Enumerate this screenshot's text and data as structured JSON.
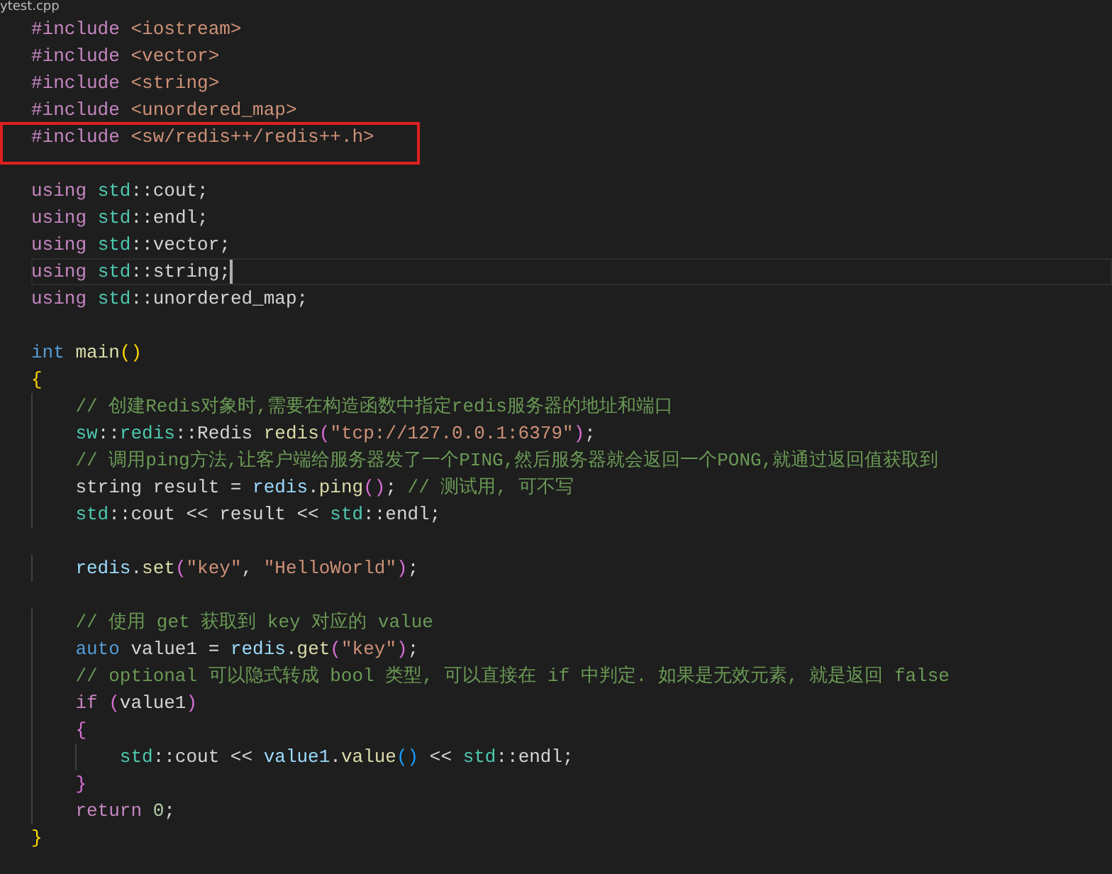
{
  "tab": {
    "title": "ytest.cpp"
  },
  "lines": [
    {
      "kind": "code",
      "tokens": [
        {
          "text": "#include",
          "kind": "pp"
        },
        {
          "text": " <iostream>",
          "kind": "str"
        }
      ]
    },
    {
      "kind": "code",
      "tokens": [
        {
          "text": "#include",
          "kind": "pp"
        },
        {
          "text": " <vector>",
          "kind": "str"
        }
      ]
    },
    {
      "kind": "code",
      "tokens": [
        {
          "text": "#include",
          "kind": "pp"
        },
        {
          "text": " <string>",
          "kind": "str"
        }
      ]
    },
    {
      "kind": "code",
      "tokens": [
        {
          "text": "#include",
          "kind": "pp"
        },
        {
          "text": " <unordered_map>",
          "kind": "str"
        }
      ]
    },
    {
      "kind": "code",
      "annotated": true,
      "tokens": [
        {
          "text": "#include",
          "kind": "pp"
        },
        {
          "text": " <sw/redis++/redis++.h>",
          "kind": "str"
        }
      ]
    },
    {
      "kind": "blank"
    },
    {
      "kind": "code",
      "tokens": [
        {
          "text": "using",
          "kind": "kw"
        },
        {
          "text": " std",
          "kind": "ns"
        },
        {
          "text": "::cout;",
          "kind": "plain"
        }
      ]
    },
    {
      "kind": "code",
      "tokens": [
        {
          "text": "using",
          "kind": "kw"
        },
        {
          "text": " std",
          "kind": "ns"
        },
        {
          "text": "::endl;",
          "kind": "plain"
        }
      ]
    },
    {
      "kind": "code",
      "tokens": [
        {
          "text": "using",
          "kind": "kw"
        },
        {
          "text": " std",
          "kind": "ns"
        },
        {
          "text": "::vector;",
          "kind": "plain"
        }
      ]
    },
    {
      "kind": "code",
      "cursor": true,
      "tokens": [
        {
          "text": "using",
          "kind": "kw"
        },
        {
          "text": " std",
          "kind": "ns"
        },
        {
          "text": "::string;",
          "kind": "plain"
        }
      ]
    },
    {
      "kind": "code",
      "tokens": [
        {
          "text": "using",
          "kind": "kw"
        },
        {
          "text": " std",
          "kind": "ns"
        },
        {
          "text": "::unordered_map;",
          "kind": "plain"
        }
      ]
    },
    {
      "kind": "blank"
    },
    {
      "kind": "code",
      "tokens": [
        {
          "text": "int",
          "kind": "type"
        },
        {
          "text": " main",
          "kind": "fn"
        },
        {
          "text": "()",
          "kind": "b1"
        }
      ]
    },
    {
      "kind": "code",
      "tokens": [
        {
          "text": "{",
          "kind": "b1"
        }
      ]
    },
    {
      "kind": "code",
      "tokens": [
        {
          "text": "    // 创建Redis对象时,需要在构造函数中指定redis服务器的地址和端口",
          "kind": "com"
        }
      ]
    },
    {
      "kind": "code",
      "tokens": [
        {
          "text": "    sw",
          "kind": "ns"
        },
        {
          "text": "::",
          "kind": "plain"
        },
        {
          "text": "redis",
          "kind": "ns"
        },
        {
          "text": "::Redis ",
          "kind": "plain"
        },
        {
          "text": "redis",
          "kind": "fn"
        },
        {
          "text": "(",
          "kind": "b2"
        },
        {
          "text": "\"tcp://127.0.0.1:6379\"",
          "kind": "str"
        },
        {
          "text": ")",
          "kind": "b2"
        },
        {
          "text": ";",
          "kind": "plain"
        }
      ]
    },
    {
      "kind": "code",
      "tokens": [
        {
          "text": "    // 调用ping方法,让客户端给服务器发了一个PING,然后服务器就会返回一个PONG,就通过返回值获取到",
          "kind": "com"
        }
      ]
    },
    {
      "kind": "code",
      "tokens": [
        {
          "text": "    string result = ",
          "kind": "plain"
        },
        {
          "text": "redis",
          "kind": "var"
        },
        {
          "text": ".",
          "kind": "plain"
        },
        {
          "text": "ping",
          "kind": "fn"
        },
        {
          "text": "()",
          "kind": "b2"
        },
        {
          "text": "; ",
          "kind": "plain"
        },
        {
          "text": "// 测试用, 可不写",
          "kind": "com"
        }
      ]
    },
    {
      "kind": "code",
      "tokens": [
        {
          "text": "    std",
          "kind": "ns"
        },
        {
          "text": "::cout << result << ",
          "kind": "plain"
        },
        {
          "text": "std",
          "kind": "ns"
        },
        {
          "text": "::endl;",
          "kind": "plain"
        }
      ]
    },
    {
      "kind": "blank"
    },
    {
      "kind": "code",
      "tokens": [
        {
          "text": "    redis",
          "kind": "var"
        },
        {
          "text": ".",
          "kind": "plain"
        },
        {
          "text": "set",
          "kind": "fn"
        },
        {
          "text": "(",
          "kind": "b2"
        },
        {
          "text": "\"key\"",
          "kind": "str"
        },
        {
          "text": ", ",
          "kind": "plain"
        },
        {
          "text": "\"HelloWorld\"",
          "kind": "str"
        },
        {
          "text": ")",
          "kind": "b2"
        },
        {
          "text": ";",
          "kind": "plain"
        }
      ]
    },
    {
      "kind": "blank"
    },
    {
      "kind": "code",
      "tokens": [
        {
          "text": "    // 使用 get 获取到 key 对应的 value",
          "kind": "com"
        }
      ]
    },
    {
      "kind": "code",
      "tokens": [
        {
          "text": "    auto",
          "kind": "type"
        },
        {
          "text": " value1 = ",
          "kind": "plain"
        },
        {
          "text": "redis",
          "kind": "var"
        },
        {
          "text": ".",
          "kind": "plain"
        },
        {
          "text": "get",
          "kind": "fn"
        },
        {
          "text": "(",
          "kind": "b2"
        },
        {
          "text": "\"key\"",
          "kind": "str"
        },
        {
          "text": ")",
          "kind": "b2"
        },
        {
          "text": ";",
          "kind": "plain"
        }
      ]
    },
    {
      "kind": "code",
      "tokens": [
        {
          "text": "    // optional 可以隐式转成 bool 类型, 可以直接在 if 中判定. 如果是无效元素, 就是返回 false",
          "kind": "com"
        }
      ]
    },
    {
      "kind": "code",
      "tokens": [
        {
          "text": "    if ",
          "kind": "kw"
        },
        {
          "text": "(",
          "kind": "b2"
        },
        {
          "text": "value1",
          "kind": "plain"
        },
        {
          "text": ")",
          "kind": "b2"
        }
      ]
    },
    {
      "kind": "code",
      "tokens": [
        {
          "text": "    {",
          "kind": "b2"
        }
      ]
    },
    {
      "kind": "code",
      "tokens": [
        {
          "text": "        std",
          "kind": "ns"
        },
        {
          "text": "::cout << ",
          "kind": "plain"
        },
        {
          "text": "value1",
          "kind": "var"
        },
        {
          "text": ".",
          "kind": "plain"
        },
        {
          "text": "value",
          "kind": "fn"
        },
        {
          "text": "()",
          "kind": "b3"
        },
        {
          "text": " << ",
          "kind": "plain"
        },
        {
          "text": "std",
          "kind": "ns"
        },
        {
          "text": "::endl;",
          "kind": "plain"
        }
      ]
    },
    {
      "kind": "code",
      "tokens": [
        {
          "text": "    }",
          "kind": "b2"
        }
      ]
    },
    {
      "kind": "code",
      "tokens": [
        {
          "text": "    return ",
          "kind": "kw"
        },
        {
          "text": "0",
          "kind": "num"
        },
        {
          "text": ";",
          "kind": "plain"
        }
      ]
    },
    {
      "kind": "code",
      "tokens": [
        {
          "text": "}",
          "kind": "b1"
        }
      ]
    }
  ]
}
